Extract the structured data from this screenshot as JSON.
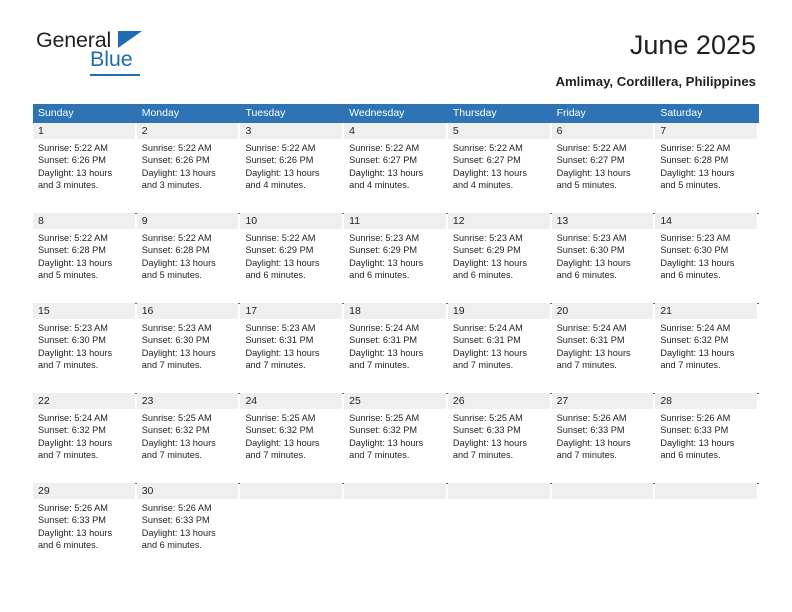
{
  "brand": {
    "name_primary": "General",
    "name_secondary": "Blue",
    "triangle_color": "#1f6cb0",
    "accent_color": "#2e74b5"
  },
  "header": {
    "title": "June 2025",
    "subtitle": "Amlimay, Cordillera, Philippines"
  },
  "calendar": {
    "weekdays": [
      "Sunday",
      "Monday",
      "Tuesday",
      "Wednesday",
      "Thursday",
      "Friday",
      "Saturday"
    ],
    "header_bg": "#2e74b5",
    "daynum_bg": "#efefef",
    "weeks": [
      [
        {
          "day": "1",
          "sunrise": "Sunrise: 5:22 AM",
          "sunset": "Sunset: 6:26 PM",
          "daylight_1": "Daylight: 13 hours",
          "daylight_2": "and 3 minutes."
        },
        {
          "day": "2",
          "sunrise": "Sunrise: 5:22 AM",
          "sunset": "Sunset: 6:26 PM",
          "daylight_1": "Daylight: 13 hours",
          "daylight_2": "and 3 minutes."
        },
        {
          "day": "3",
          "sunrise": "Sunrise: 5:22 AM",
          "sunset": "Sunset: 6:26 PM",
          "daylight_1": "Daylight: 13 hours",
          "daylight_2": "and 4 minutes."
        },
        {
          "day": "4",
          "sunrise": "Sunrise: 5:22 AM",
          "sunset": "Sunset: 6:27 PM",
          "daylight_1": "Daylight: 13 hours",
          "daylight_2": "and 4 minutes."
        },
        {
          "day": "5",
          "sunrise": "Sunrise: 5:22 AM",
          "sunset": "Sunset: 6:27 PM",
          "daylight_1": "Daylight: 13 hours",
          "daylight_2": "and 4 minutes."
        },
        {
          "day": "6",
          "sunrise": "Sunrise: 5:22 AM",
          "sunset": "Sunset: 6:27 PM",
          "daylight_1": "Daylight: 13 hours",
          "daylight_2": "and 5 minutes."
        },
        {
          "day": "7",
          "sunrise": "Sunrise: 5:22 AM",
          "sunset": "Sunset: 6:28 PM",
          "daylight_1": "Daylight: 13 hours",
          "daylight_2": "and 5 minutes."
        }
      ],
      [
        {
          "day": "8",
          "sunrise": "Sunrise: 5:22 AM",
          "sunset": "Sunset: 6:28 PM",
          "daylight_1": "Daylight: 13 hours",
          "daylight_2": "and 5 minutes."
        },
        {
          "day": "9",
          "sunrise": "Sunrise: 5:22 AM",
          "sunset": "Sunset: 6:28 PM",
          "daylight_1": "Daylight: 13 hours",
          "daylight_2": "and 5 minutes."
        },
        {
          "day": "10",
          "sunrise": "Sunrise: 5:22 AM",
          "sunset": "Sunset: 6:29 PM",
          "daylight_1": "Daylight: 13 hours",
          "daylight_2": "and 6 minutes."
        },
        {
          "day": "11",
          "sunrise": "Sunrise: 5:23 AM",
          "sunset": "Sunset: 6:29 PM",
          "daylight_1": "Daylight: 13 hours",
          "daylight_2": "and 6 minutes."
        },
        {
          "day": "12",
          "sunrise": "Sunrise: 5:23 AM",
          "sunset": "Sunset: 6:29 PM",
          "daylight_1": "Daylight: 13 hours",
          "daylight_2": "and 6 minutes."
        },
        {
          "day": "13",
          "sunrise": "Sunrise: 5:23 AM",
          "sunset": "Sunset: 6:30 PM",
          "daylight_1": "Daylight: 13 hours",
          "daylight_2": "and 6 minutes."
        },
        {
          "day": "14",
          "sunrise": "Sunrise: 5:23 AM",
          "sunset": "Sunset: 6:30 PM",
          "daylight_1": "Daylight: 13 hours",
          "daylight_2": "and 6 minutes."
        }
      ],
      [
        {
          "day": "15",
          "sunrise": "Sunrise: 5:23 AM",
          "sunset": "Sunset: 6:30 PM",
          "daylight_1": "Daylight: 13 hours",
          "daylight_2": "and 7 minutes."
        },
        {
          "day": "16",
          "sunrise": "Sunrise: 5:23 AM",
          "sunset": "Sunset: 6:30 PM",
          "daylight_1": "Daylight: 13 hours",
          "daylight_2": "and 7 minutes."
        },
        {
          "day": "17",
          "sunrise": "Sunrise: 5:23 AM",
          "sunset": "Sunset: 6:31 PM",
          "daylight_1": "Daylight: 13 hours",
          "daylight_2": "and 7 minutes."
        },
        {
          "day": "18",
          "sunrise": "Sunrise: 5:24 AM",
          "sunset": "Sunset: 6:31 PM",
          "daylight_1": "Daylight: 13 hours",
          "daylight_2": "and 7 minutes."
        },
        {
          "day": "19",
          "sunrise": "Sunrise: 5:24 AM",
          "sunset": "Sunset: 6:31 PM",
          "daylight_1": "Daylight: 13 hours",
          "daylight_2": "and 7 minutes."
        },
        {
          "day": "20",
          "sunrise": "Sunrise: 5:24 AM",
          "sunset": "Sunset: 6:31 PM",
          "daylight_1": "Daylight: 13 hours",
          "daylight_2": "and 7 minutes."
        },
        {
          "day": "21",
          "sunrise": "Sunrise: 5:24 AM",
          "sunset": "Sunset: 6:32 PM",
          "daylight_1": "Daylight: 13 hours",
          "daylight_2": "and 7 minutes."
        }
      ],
      [
        {
          "day": "22",
          "sunrise": "Sunrise: 5:24 AM",
          "sunset": "Sunset: 6:32 PM",
          "daylight_1": "Daylight: 13 hours",
          "daylight_2": "and 7 minutes."
        },
        {
          "day": "23",
          "sunrise": "Sunrise: 5:25 AM",
          "sunset": "Sunset: 6:32 PM",
          "daylight_1": "Daylight: 13 hours",
          "daylight_2": "and 7 minutes."
        },
        {
          "day": "24",
          "sunrise": "Sunrise: 5:25 AM",
          "sunset": "Sunset: 6:32 PM",
          "daylight_1": "Daylight: 13 hours",
          "daylight_2": "and 7 minutes."
        },
        {
          "day": "25",
          "sunrise": "Sunrise: 5:25 AM",
          "sunset": "Sunset: 6:32 PM",
          "daylight_1": "Daylight: 13 hours",
          "daylight_2": "and 7 minutes."
        },
        {
          "day": "26",
          "sunrise": "Sunrise: 5:25 AM",
          "sunset": "Sunset: 6:33 PM",
          "daylight_1": "Daylight: 13 hours",
          "daylight_2": "and 7 minutes."
        },
        {
          "day": "27",
          "sunrise": "Sunrise: 5:26 AM",
          "sunset": "Sunset: 6:33 PM",
          "daylight_1": "Daylight: 13 hours",
          "daylight_2": "and 7 minutes."
        },
        {
          "day": "28",
          "sunrise": "Sunrise: 5:26 AM",
          "sunset": "Sunset: 6:33 PM",
          "daylight_1": "Daylight: 13 hours",
          "daylight_2": "and 6 minutes."
        }
      ],
      [
        {
          "day": "29",
          "sunrise": "Sunrise: 5:26 AM",
          "sunset": "Sunset: 6:33 PM",
          "daylight_1": "Daylight: 13 hours",
          "daylight_2": "and 6 minutes."
        },
        {
          "day": "30",
          "sunrise": "Sunrise: 5:26 AM",
          "sunset": "Sunset: 6:33 PM",
          "daylight_1": "Daylight: 13 hours",
          "daylight_2": "and 6 minutes."
        },
        {
          "day": "",
          "sunrise": "",
          "sunset": "",
          "daylight_1": "",
          "daylight_2": ""
        },
        {
          "day": "",
          "sunrise": "",
          "sunset": "",
          "daylight_1": "",
          "daylight_2": ""
        },
        {
          "day": "",
          "sunrise": "",
          "sunset": "",
          "daylight_1": "",
          "daylight_2": ""
        },
        {
          "day": "",
          "sunrise": "",
          "sunset": "",
          "daylight_1": "",
          "daylight_2": ""
        },
        {
          "day": "",
          "sunrise": "",
          "sunset": "",
          "daylight_1": "",
          "daylight_2": ""
        }
      ]
    ]
  }
}
